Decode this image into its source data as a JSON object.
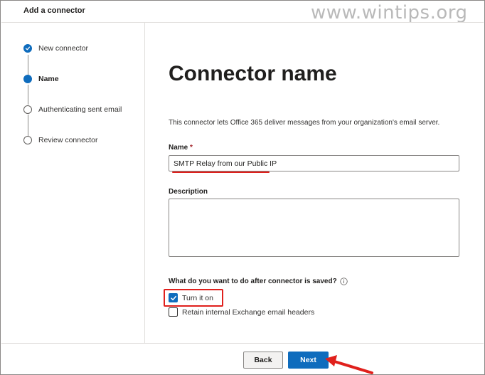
{
  "dialog": {
    "title": "Add a connector",
    "watermark": "www.wintips.org"
  },
  "stepper": {
    "steps": [
      {
        "label": "New connector",
        "state": "done"
      },
      {
        "label": "Name",
        "state": "current"
      },
      {
        "label": "Authenticating sent email",
        "state": "pending"
      },
      {
        "label": "Review connector",
        "state": "pending"
      }
    ]
  },
  "main": {
    "heading": "Connector name",
    "description": "This connector lets Office 365 deliver messages from your organization's email server.",
    "name_field": {
      "label": "Name",
      "required_mark": "*",
      "value": "SMTP Relay from our Public IP"
    },
    "description_field": {
      "label": "Description",
      "value": ""
    },
    "after_save": {
      "question": "What do you want to do after connector is saved?",
      "options": [
        {
          "label": "Turn it on",
          "checked": true
        },
        {
          "label": "Retain internal Exchange email headers",
          "checked": false
        }
      ]
    }
  },
  "footer": {
    "back_label": "Back",
    "next_label": "Next"
  },
  "colors": {
    "accent": "#0f6cbd",
    "annotation_red": "#e0201c"
  }
}
